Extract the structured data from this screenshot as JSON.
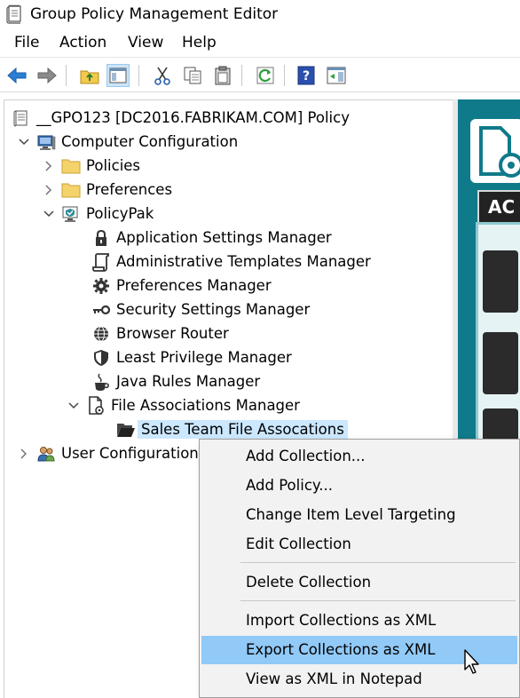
{
  "window": {
    "title": "Group Policy Management Editor",
    "icon": "notepad-policy-icon"
  },
  "menubar": {
    "items": [
      "File",
      "Action",
      "View",
      "Help"
    ]
  },
  "toolbar": {
    "buttons": [
      "back-arrow-icon",
      "forward-arrow-icon",
      "up-folder-icon",
      "show-hide-tree-icon",
      "cut-icon",
      "copy-icon",
      "paste-icon",
      "refresh-icon",
      "help-icon",
      "show-action-pane-icon"
    ],
    "active": "show-hide-tree-icon"
  },
  "tree": {
    "root": "__GPO123 [DC2016.FABRIKAM.COM] Policy",
    "computer_configuration": "Computer Configuration",
    "policies": "Policies",
    "preferences": "Preferences",
    "policypak": "PolicyPak",
    "app_settings": "Application Settings Manager",
    "admin_templates": "Administrative Templates Manager",
    "preferences_manager": "Preferences Manager",
    "security_settings": "Security Settings Manager",
    "browser_router": "Browser Router",
    "least_privilege": "Least Privilege Manager",
    "java_rules": "Java Rules Manager",
    "file_associations": "File Associations Manager",
    "sales_team": "Sales Team File Assocations",
    "user_configuration": "User Configuration"
  },
  "right_pane": {
    "tab_label": "AC"
  },
  "context_menu": {
    "add_collection": "Add Collection...",
    "add_policy": "Add Policy...",
    "change_targeting": "Change Item Level Targeting",
    "edit_collection": "Edit Collection",
    "delete_collection": "Delete Collection",
    "import_xml": "Import Collections as XML",
    "export_xml": "Export Collections as XML",
    "view_xml": "View as XML in Notepad",
    "highlighted": "Export Collections as XML"
  },
  "colors": {
    "selection": "#cce8ff",
    "menu_hover": "#91c9f7",
    "right_pane_teal": "#0f7a8a"
  }
}
